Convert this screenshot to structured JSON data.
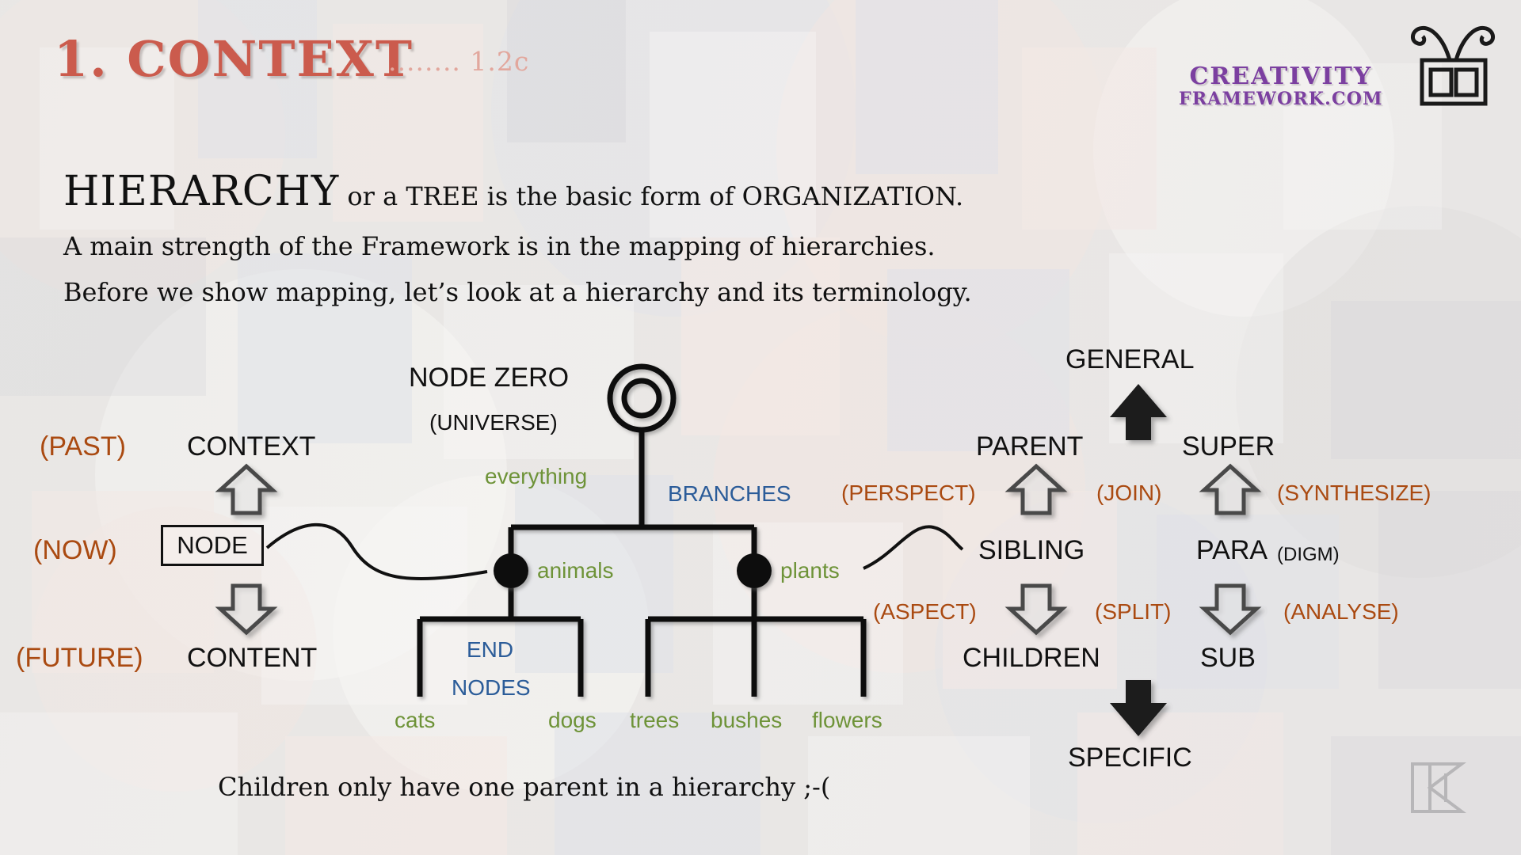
{
  "header": {
    "section_title": "1. CONTEXT",
    "section_number": "........ 1.2c"
  },
  "brand": {
    "line1": "CREATIVITY",
    "line2": "FRAMEWORK.COM",
    "mark_icon": "antenna-box-icon",
    "corner_icon": "daw-monogram-icon"
  },
  "headline": {
    "line1_strong": "HIERARCHY",
    "line1_rest": " or a TREE is the basic form of ORGANIZATION.",
    "line2": "A main strength of the Framework is in the mapping of hierarchies.",
    "line3": "Before we show mapping, let’s look at a hierarchy and its terminology."
  },
  "footnote": "Children only have one parent in a hierarchy ;-(",
  "left_column": {
    "past": "(PAST)",
    "now": "(NOW)",
    "future": "(FUTURE)",
    "context": "CONTEXT",
    "node": "NODE",
    "content": "CONTENT",
    "up_arrow_icon": "hollow-up-arrow-icon",
    "down_arrow_icon": "hollow-down-arrow-icon"
  },
  "tree": {
    "node_zero": "NODE ZERO",
    "node_zero_sub": "(UNIVERSE)",
    "root_label": "everything",
    "branches_label": "BRANCHES",
    "end_nodes_label_line1": "END",
    "end_nodes_label_line2": "NODES",
    "children": [
      {
        "label": "animals"
      },
      {
        "label": "plants"
      }
    ],
    "leaves": [
      {
        "label": "cats"
      },
      {
        "label": "dogs"
      },
      {
        "label": "trees"
      },
      {
        "label": "bushes"
      },
      {
        "label": "flowers"
      }
    ],
    "root_icon": "double-circle-node-icon",
    "node-dot_icon": "filled-dot-node-icon"
  },
  "right_column": {
    "general": "GENERAL",
    "specific": "SPECIFIC",
    "parent": "PARENT",
    "children": "CHILDREN",
    "super": "SUPER",
    "sub": "SUB",
    "sibling": "SIBLING",
    "para": "PARA",
    "para_sub": "(DIGM)",
    "perspect": "(PERSPECT)",
    "aspect": "(ASPECT)",
    "join": "(JOIN)",
    "split": "(SPLIT)",
    "synthesize": "(SYNTHESIZE)",
    "analyse": "(ANALYSE)",
    "big_up_arrow_icon": "solid-up-arrow-icon",
    "big_down_arrow_icon": "solid-down-arrow-icon",
    "up_arrow_icon": "hollow-up-arrow-icon",
    "down_arrow_icon": "hollow-down-arrow-icon"
  },
  "colors": {
    "title_red": "#cb5b4d",
    "brand_purple": "#7b3fa0",
    "brown": "#aa4a11",
    "green": "#6e9338",
    "blue": "#2b5c99",
    "ink": "#111111",
    "background": "#e6e4e2"
  }
}
